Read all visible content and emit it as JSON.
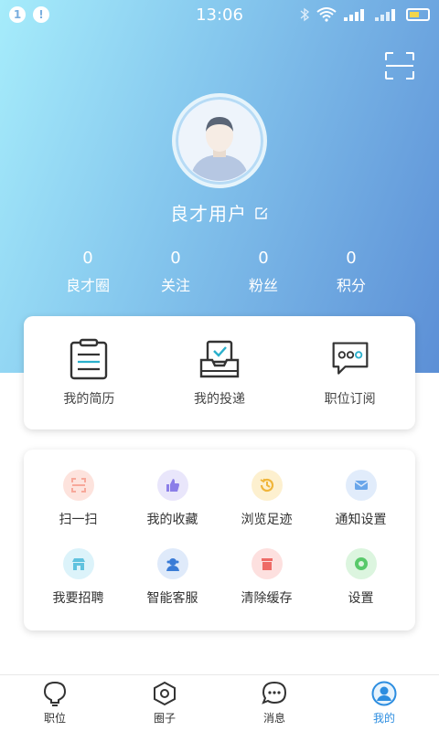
{
  "status_bar": {
    "badge1": "1",
    "badge2": "!",
    "time": "13:06",
    "signal_text": "all"
  },
  "profile": {
    "username": "良才用户",
    "stats": [
      {
        "value": "0",
        "label": "良才圈"
      },
      {
        "value": "0",
        "label": "关注"
      },
      {
        "value": "0",
        "label": "粉丝"
      },
      {
        "value": "0",
        "label": "积分"
      }
    ]
  },
  "card_primary": [
    {
      "label": "我的简历",
      "icon": "resume-icon"
    },
    {
      "label": "我的投递",
      "icon": "delivery-icon"
    },
    {
      "label": "职位订阅",
      "icon": "subscription-icon"
    }
  ],
  "card_tools": [
    {
      "label": "扫一扫",
      "icon": "scan-icon",
      "color": "#f7a89a",
      "bg": "#fde3dd"
    },
    {
      "label": "我的收藏",
      "icon": "thumbs-up-icon",
      "color": "#8b7ee8",
      "bg": "#e9e6fb"
    },
    {
      "label": "浏览足迹",
      "icon": "history-icon",
      "color": "#f0b53a",
      "bg": "#fdf0cf"
    },
    {
      "label": "通知设置",
      "icon": "mail-icon",
      "color": "#6aa6ea",
      "bg": "#e1ecfb"
    },
    {
      "label": "我要招聘",
      "icon": "shop-icon",
      "color": "#5fc2de",
      "bg": "#dcf3fa"
    },
    {
      "label": "智能客服",
      "icon": "service-icon",
      "color": "#3a7bd6",
      "bg": "#dfeafa"
    },
    {
      "label": "清除缓存",
      "icon": "trash-icon",
      "color": "#ee6a66",
      "bg": "#fde0df"
    },
    {
      "label": "设置",
      "icon": "settings-icon",
      "color": "#58c96a",
      "bg": "#dcf5df"
    }
  ],
  "bottom_nav": [
    {
      "label": "职位",
      "icon": "bulb-icon"
    },
    {
      "label": "圈子",
      "icon": "hexagon-icon"
    },
    {
      "label": "消息",
      "icon": "message-icon"
    },
    {
      "label": "我的",
      "icon": "user-icon",
      "active": true
    }
  ],
  "colors": {
    "accent": "#2c8de0",
    "gradient_start": "#a6ecfb",
    "gradient_end": "#5c8fd6"
  }
}
